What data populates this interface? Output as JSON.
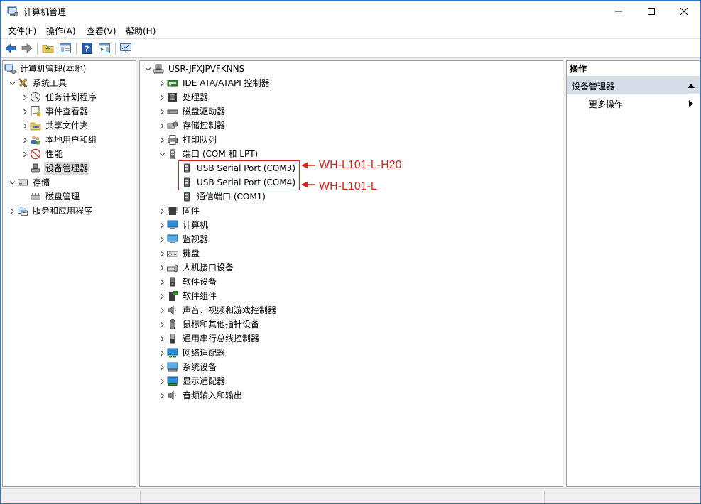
{
  "window": {
    "title": "计算机管理"
  },
  "menu": [
    "文件(F)",
    "操作(A)",
    "查看(V)",
    "帮助(H)"
  ],
  "toolbar": {
    "buttons": [
      "back-icon",
      "forward-icon",
      "up-folder-icon",
      "show-hide-console-tree-icon",
      "help-icon",
      "show-hide-action-pane-icon",
      "monitor-icon"
    ]
  },
  "left_tree": [
    {
      "label": "计算机管理(本地)",
      "icon": "computer-management-icon"
    },
    {
      "label": "系统工具",
      "icon": "tools-icon"
    },
    {
      "label": "任务计划程序",
      "icon": "clock-icon"
    },
    {
      "label": "事件查看器",
      "icon": "event-viewer-icon"
    },
    {
      "label": "共享文件夹",
      "icon": "shared-folder-icon"
    },
    {
      "label": "本地用户和组",
      "icon": "users-icon"
    },
    {
      "label": "性能",
      "icon": "performance-icon"
    },
    {
      "label": "设备管理器",
      "icon": "device-manager-icon"
    },
    {
      "label": "存储",
      "icon": "storage-icon"
    },
    {
      "label": "磁盘管理",
      "icon": "disk-management-icon"
    },
    {
      "label": "服务和应用程序",
      "icon": "services-icon"
    }
  ],
  "device_tree": {
    "root": "USR-JFXJPVFKNNS",
    "items": [
      {
        "label": "IDE ATA/ATAPI 控制器",
        "icon": "ide-controller-icon"
      },
      {
        "label": "处理器",
        "icon": "processor-icon"
      },
      {
        "label": "磁盘驱动器",
        "icon": "disk-drive-icon"
      },
      {
        "label": "存储控制器",
        "icon": "storage-controller-icon"
      },
      {
        "label": "打印队列",
        "icon": "printer-icon"
      },
      {
        "label": "端口 (COM 和 LPT)",
        "icon": "port-icon"
      },
      {
        "label": "USB Serial Port (COM3)",
        "icon": "port-icon"
      },
      {
        "label": "USB Serial Port (COM4)",
        "icon": "port-icon"
      },
      {
        "label": "通信端口 (COM1)",
        "icon": "port-icon"
      },
      {
        "label": "固件",
        "icon": "firmware-icon"
      },
      {
        "label": "计算机",
        "icon": "computer-icon"
      },
      {
        "label": "监视器",
        "icon": "monitor-icon"
      },
      {
        "label": "键盘",
        "icon": "keyboard-icon"
      },
      {
        "label": "人机接口设备",
        "icon": "hid-icon"
      },
      {
        "label": "软件设备",
        "icon": "software-device-icon"
      },
      {
        "label": "软件组件",
        "icon": "software-component-icon"
      },
      {
        "label": "声音、视频和游戏控制器",
        "icon": "speaker-icon"
      },
      {
        "label": "鼠标和其他指针设备",
        "icon": "mouse-icon"
      },
      {
        "label": "通用串行总线控制器",
        "icon": "usb-icon"
      },
      {
        "label": "网络适配器",
        "icon": "network-adapter-icon"
      },
      {
        "label": "系统设备",
        "icon": "system-device-icon"
      },
      {
        "label": "显示适配器",
        "icon": "display-adapter-icon"
      },
      {
        "label": "音频输入和输出",
        "icon": "audio-io-icon"
      }
    ]
  },
  "annotations": [
    "WH-L101-L-H20",
    "WH-L101-L"
  ],
  "actions": {
    "header": "操作",
    "section": "设备管理器",
    "more": "更多操作"
  },
  "colors": {
    "annotation": "#e3201b",
    "selection": "#d9d9d9",
    "action_section": "#d4dde8"
  }
}
